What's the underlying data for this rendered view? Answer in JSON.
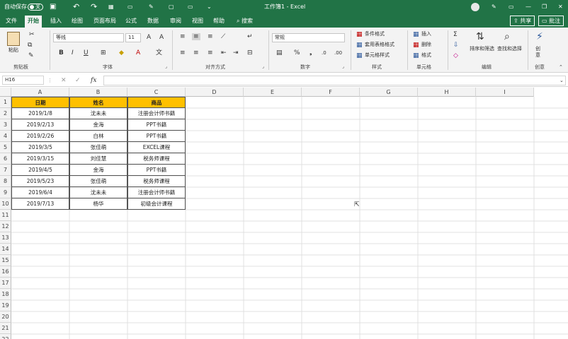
{
  "titlebar": {
    "autosave_label": "自动保存",
    "autosave_state": "关",
    "title": "工作簿1 - Excel",
    "share_label": "共享",
    "comments_label": "批注"
  },
  "tabs": [
    "文件",
    "开始",
    "插入",
    "绘图",
    "页面布局",
    "公式",
    "数据",
    "审阅",
    "视图",
    "帮助"
  ],
  "search_label": "搜索",
  "ribbon": {
    "clipboard": {
      "paste": "粘贴",
      "group": "剪贴板"
    },
    "font": {
      "name": "等线",
      "size": "11",
      "group": "字体"
    },
    "alignment": {
      "group": "对齐方式"
    },
    "number": {
      "format": "常规",
      "group": "数字"
    },
    "styles": {
      "conditional": "条件格式",
      "table": "套用表格格式",
      "cell": "单元格样式",
      "group": "样式"
    },
    "cells": {
      "insert": "插入",
      "delete": "删除",
      "format": "格式",
      "group": "单元格"
    },
    "editing": {
      "sort": "排序和筛选",
      "find": "查找和选择",
      "group": "编辑"
    },
    "ideas": {
      "label": "创意",
      "button": "创意"
    }
  },
  "formula_bar": {
    "name_box": "H16",
    "fx": "fx",
    "value": ""
  },
  "columns": [
    "A",
    "B",
    "C",
    "D",
    "E",
    "F",
    "G",
    "H",
    "I"
  ],
  "rows": [
    "1",
    "2",
    "3",
    "4",
    "5",
    "6",
    "7",
    "8",
    "9",
    "10",
    "11",
    "12",
    "13",
    "14",
    "15",
    "16",
    "17",
    "18",
    "19",
    "20",
    "21",
    "22"
  ],
  "table": {
    "headers": [
      "日期",
      "姓名",
      "商品"
    ],
    "rows": [
      [
        "2019/1/8",
        "沈未未",
        "注册会计师书籍"
      ],
      [
        "2019/2/13",
        "金海",
        "PPT书籍"
      ],
      [
        "2019/2/26",
        "白林",
        "PPT书籍"
      ],
      [
        "2019/3/5",
        "张佳萌",
        "EXCEL课程"
      ],
      [
        "2019/3/15",
        "刘佳慧",
        "税务师课程"
      ],
      [
        "2019/4/5",
        "金海",
        "PPT书籍"
      ],
      [
        "2019/5/23",
        "张佳萌",
        "税务师课程"
      ],
      [
        "2019/6/4",
        "沈未未",
        "注册会计师书籍"
      ],
      [
        "2019/7/13",
        "杨华",
        "初级会计课程"
      ]
    ]
  },
  "colors": {
    "excel_green": "#217346",
    "header_fill": "#ffc000"
  }
}
